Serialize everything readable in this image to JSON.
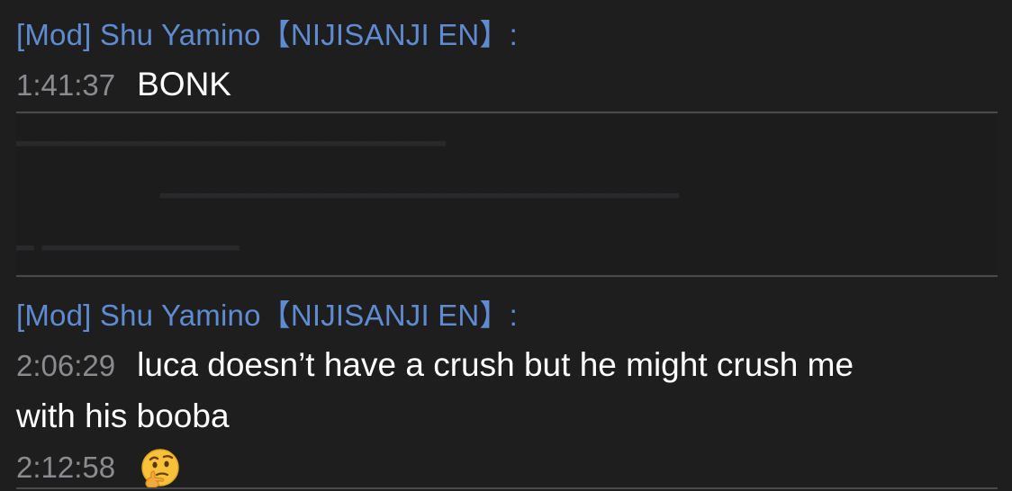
{
  "messages": [
    {
      "author": "[Mod] Shu Yamino【NIJISANJI EN】:",
      "timestamp": "1:41:37",
      "text": "BONK"
    },
    {
      "author": "[Mod] Shu Yamino【NIJISANJI EN】:",
      "timestamp": "2:06:29",
      "text": "luca doesn’t have a crush but he might crush me",
      "text_cont": "with his booba"
    },
    {
      "timestamp": "2:12:58",
      "emoji": "thinking-face-emoji"
    }
  ],
  "colors": {
    "background": "#1e1e1f",
    "author": "#5f8bd0",
    "timestamp": "#8b8b8f",
    "text": "#ffffff",
    "divider": "#4a4a4d"
  }
}
